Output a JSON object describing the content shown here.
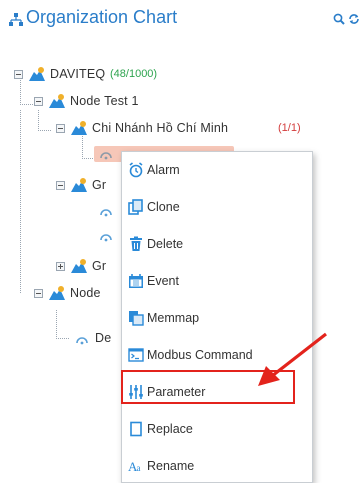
{
  "header": {
    "title": "Organization Chart",
    "icon": "org-chart-icon",
    "tools": [
      "zoom-icon",
      "refresh-icon"
    ],
    "accent_color": "#2a7dc9"
  },
  "tree": {
    "nodes": [
      {
        "label": "DAVITEQ",
        "count": "(48/1000)",
        "icon": "folder-person-icon"
      },
      {
        "label": "Node Test 1",
        "icon": "folder-person-icon"
      },
      {
        "label": "Chi Nhánh Hồ Chí Minh",
        "count": "(1/1)",
        "icon": "folder-person-icon"
      },
      {
        "label": "Gr",
        "icon": "folder-person-icon"
      },
      {
        "label": "Gr",
        "icon": "folder-person-icon"
      },
      {
        "label": "Node",
        "icon": "folder-person-icon"
      },
      {
        "label": "De",
        "icon": "device-icon"
      }
    ],
    "count_colors": {
      "green": "#2ea44f",
      "red": "#d33c3c"
    },
    "selected_color": "#f6c7b8"
  },
  "context_menu": {
    "items": [
      {
        "label": "Alarm",
        "icon": "alarm-clock-icon"
      },
      {
        "label": "Clone",
        "icon": "clone-icon"
      },
      {
        "label": "Delete",
        "icon": "trash-icon"
      },
      {
        "label": "Event",
        "icon": "calendar-icon"
      },
      {
        "label": "Memmap",
        "icon": "memmap-icon"
      },
      {
        "label": "Modbus Command",
        "icon": "terminal-icon"
      },
      {
        "label": "Parameter",
        "icon": "sliders-icon"
      },
      {
        "label": "Replace",
        "icon": "replace-icon"
      },
      {
        "label": "Rename",
        "icon": "rename-icon"
      }
    ],
    "highlighted_item": "Parameter",
    "highlight_color": "#e3231c"
  }
}
